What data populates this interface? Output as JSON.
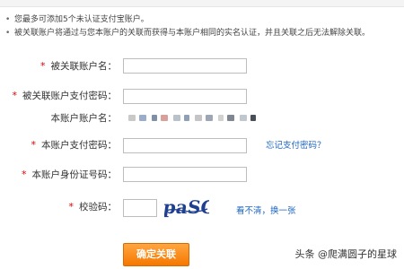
{
  "notice": {
    "bullet": "•",
    "line1": "您最多可添加5个未认证支付宝账户。",
    "line2": "被关联账户将通过与您本账户的关联而获得与本账户相同的实名认证，并且关联之后无法解除关联。"
  },
  "form": {
    "linked_account_label": "被关联账户名：",
    "linked_pay_password_label": "被关联账户支付密码：",
    "own_account_label": "本账户账户名：",
    "own_pay_password_label": "本账户支付密码：",
    "forgot_password_link": "忘记支付密码？",
    "own_id_label": "本账户身份证号码：",
    "captcha_label": "校验码：",
    "captcha_text": "paSC",
    "captcha_refresh_link": "看不清，换一张",
    "submit_label": "确定关联",
    "required_mark": "*"
  },
  "masked_account_colors": [
    "#c9c9c9",
    "#9aaecb",
    "#7f8fa7",
    "#d7a09a",
    "#b9c2c9",
    "#8f9fb8",
    "#c5c5c5",
    "#9da6b5",
    "#d1d1d1",
    "#7e8792",
    "#c0c7cf",
    "#4a4f57"
  ],
  "watermark": "头条 @爬满圆子的星球",
  "colors": {
    "required": "#e00000",
    "link": "#1d65c1",
    "button": "#f57700"
  }
}
